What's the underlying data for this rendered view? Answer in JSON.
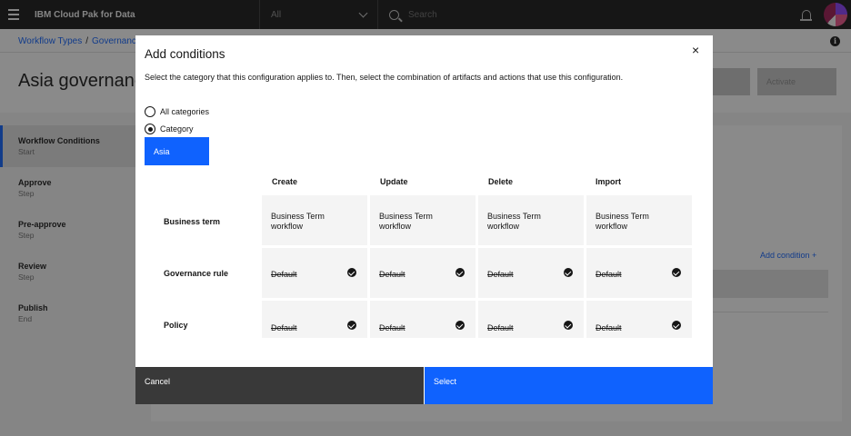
{
  "header": {
    "brand": "IBM Cloud Pak for Data",
    "scope_selected": "All",
    "search_placeholder": "Search"
  },
  "breadcrumb": {
    "items": [
      "Workflow Types",
      "Governance"
    ]
  },
  "page": {
    "title": "Asia governance",
    "activate_label": "Activate"
  },
  "steps": [
    {
      "title": "Workflow Conditions",
      "sub": "Start"
    },
    {
      "title": "Approve",
      "sub": "Step"
    },
    {
      "title": "Pre-approve",
      "sub": "Step"
    },
    {
      "title": "Review",
      "sub": "Step"
    },
    {
      "title": "Publish",
      "sub": "End"
    }
  ],
  "content": {
    "add_condition_label": "Add condition +"
  },
  "modal": {
    "title": "Add conditions",
    "close_glyph": "×",
    "description": "Select the category that this configuration applies to. Then, select the combination of artifacts and actions that use this configuration.",
    "radios": [
      {
        "label": "All categories",
        "selected": false
      },
      {
        "label": "Category",
        "selected": true
      }
    ],
    "selected_category": "Asia",
    "columns": [
      "Create",
      "Update",
      "Delete",
      "Import"
    ],
    "rows": [
      {
        "label": "Business term",
        "cells": [
          "Business Term workflow",
          "Business Term workflow",
          "Business Term workflow",
          "Business Term workflow"
        ]
      },
      {
        "label": "Governance rule",
        "cells": [
          "Default",
          "Default",
          "Default",
          "Default"
        ]
      },
      {
        "label": "Policy",
        "cells": [
          "Default",
          "Default",
          "Default",
          "Default"
        ]
      }
    ],
    "cancel_label": "Cancel",
    "select_label": "Select"
  },
  "colors": {
    "accent": "#0f62fe",
    "header_bg": "#161616",
    "cancel_bg": "#393939"
  }
}
